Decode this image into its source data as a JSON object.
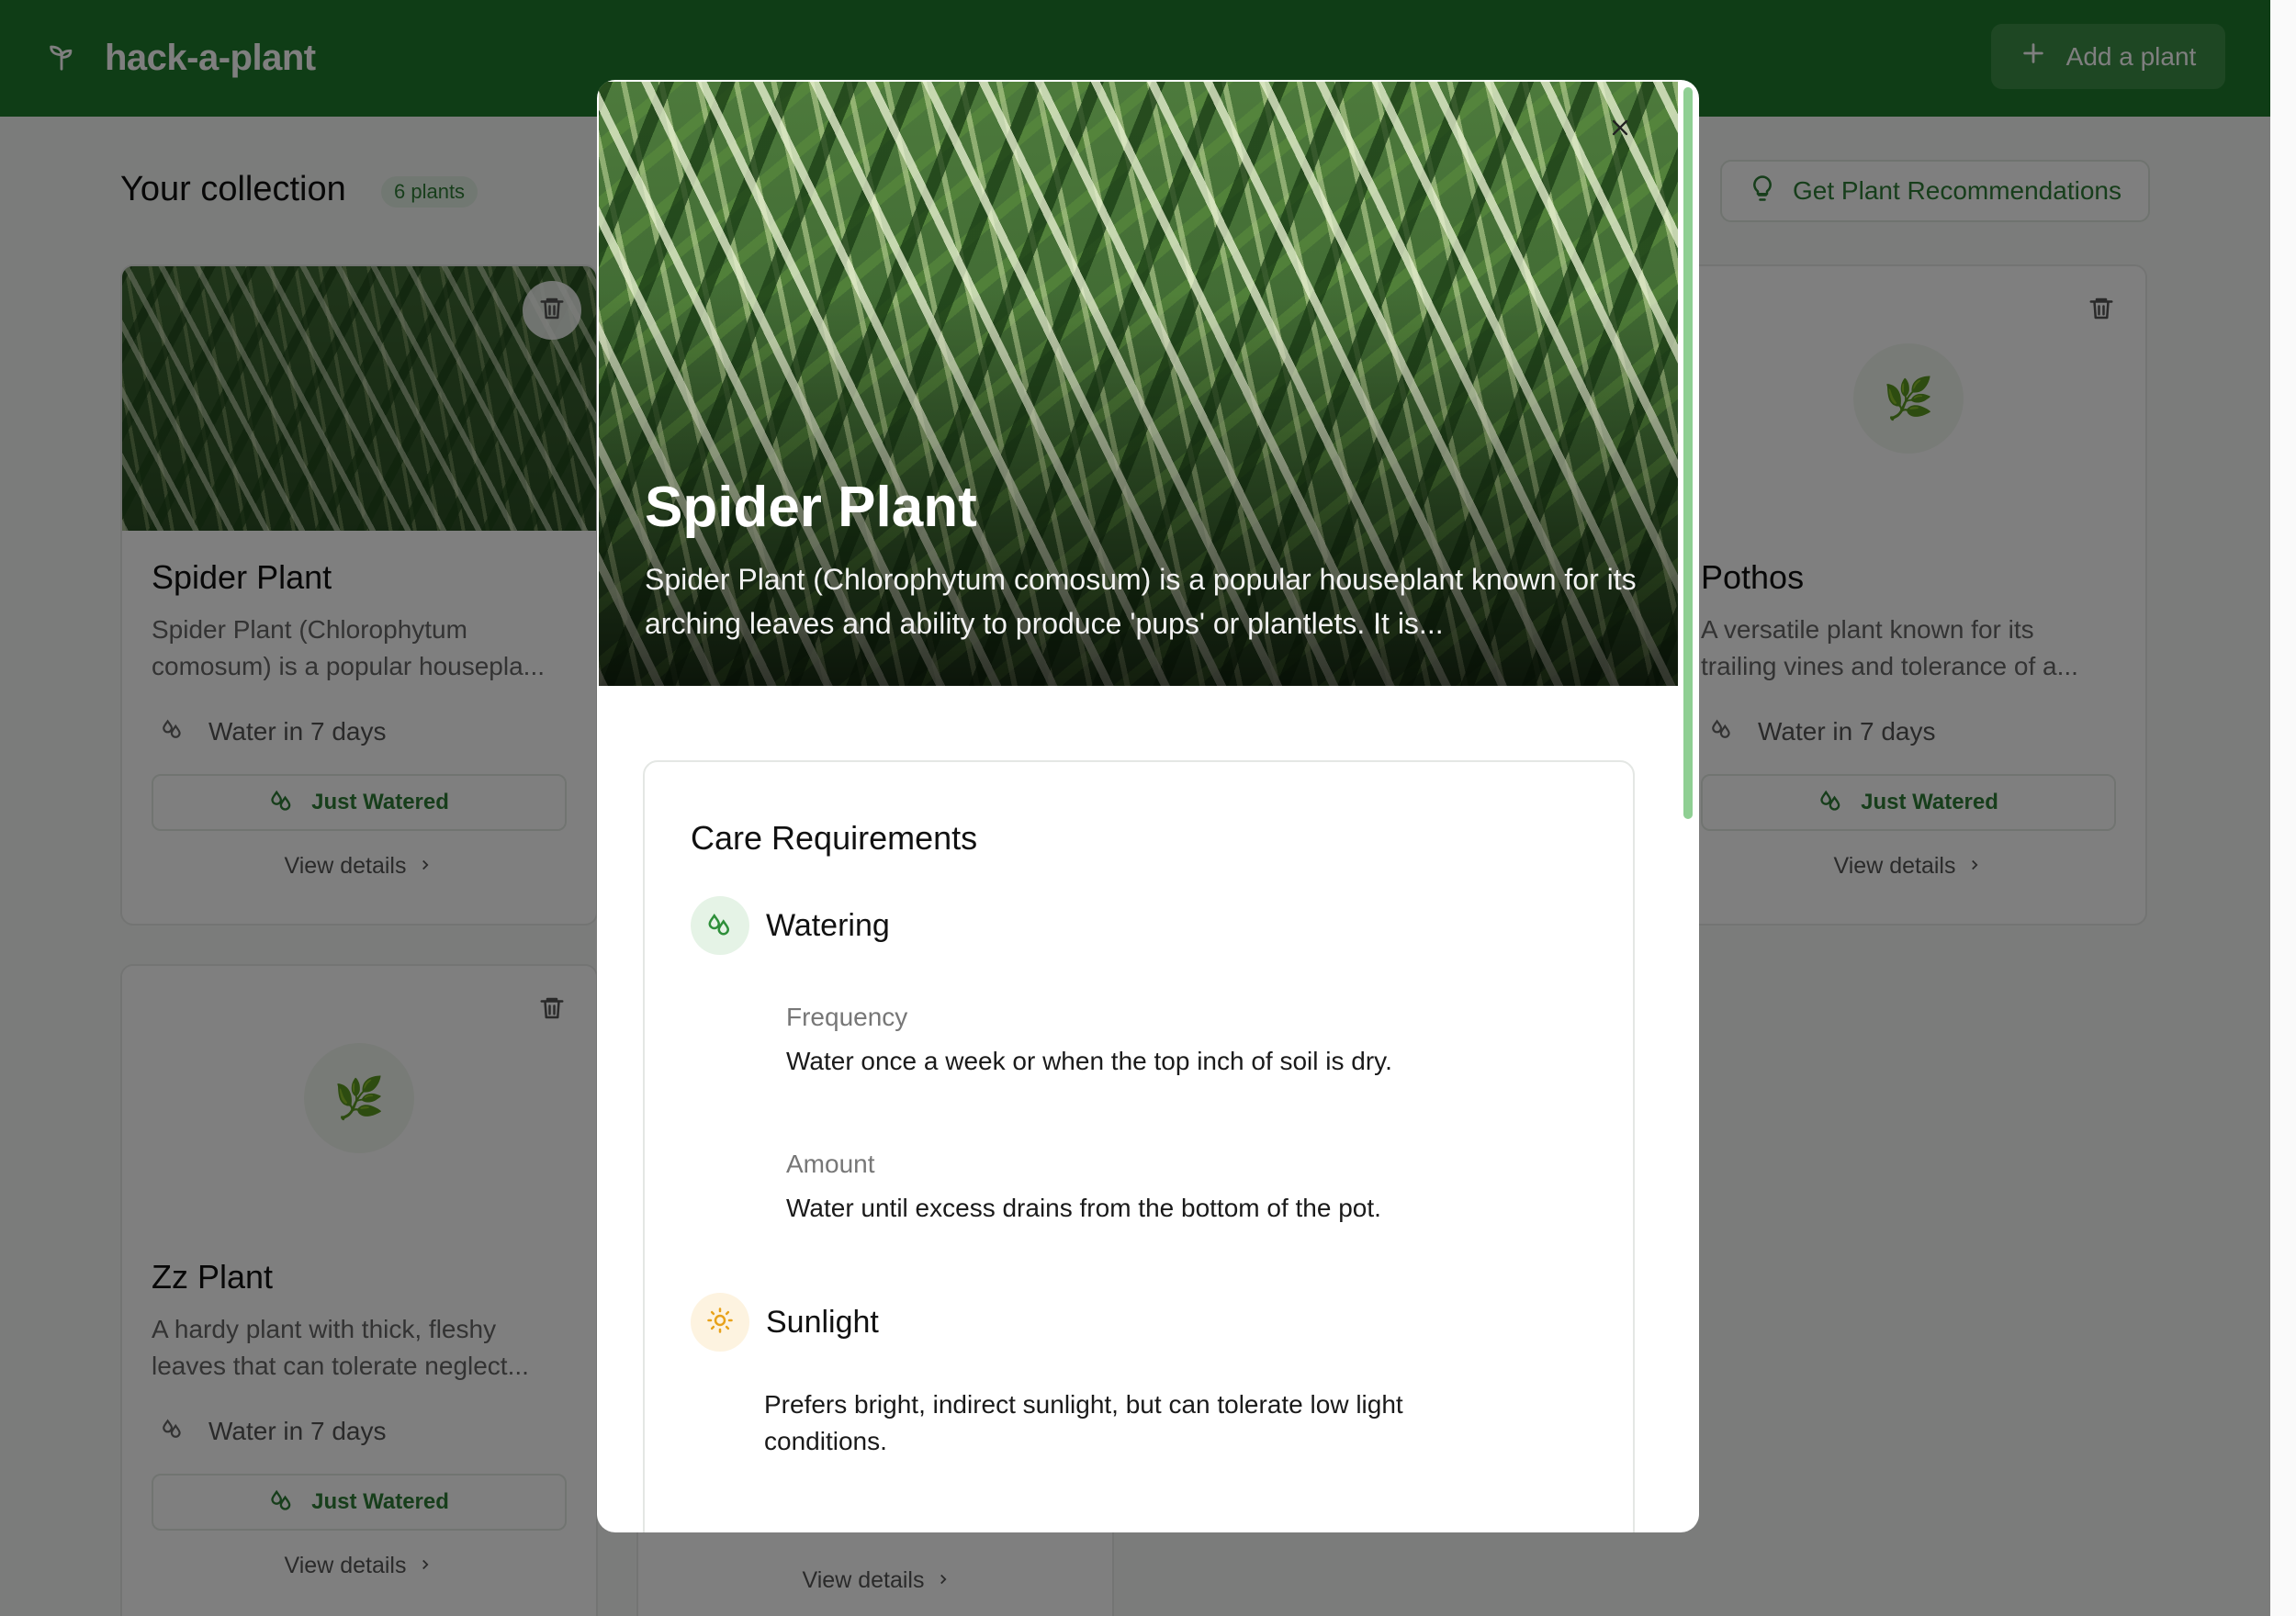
{
  "app": {
    "name": "hack-a-plant",
    "add_button": "Add a plant"
  },
  "collection": {
    "title": "Your collection",
    "count": "6 plants",
    "recommend_button": "Get Plant Recommendations"
  },
  "cards": [
    {
      "name": "Spider Plant",
      "description": "Spider Plant (Chlorophytum comosum) is a popular housepla...",
      "water": "Water in 7 days",
      "watered_button": "Just Watered",
      "details": "View details"
    },
    {
      "name": "Pothos",
      "description": "A versatile plant known for its trailing vines and tolerance of a...",
      "water": "Water in 7 days",
      "watered_button": "Just Watered",
      "details": "View details"
    },
    {
      "name": "Zz Plant",
      "description": "A hardy plant with thick, fleshy leaves that can tolerate neglect...",
      "water": "Water in 7 days",
      "watered_button": "Just Watered",
      "details": "View details"
    },
    {
      "details": "View details"
    }
  ],
  "modal": {
    "title": "Spider Plant",
    "description": "Spider Plant (Chlorophytum comosum) is a popular houseplant known for its arching leaves and ability to produce 'pups' or plantlets. It is...",
    "care": {
      "title": "Care Requirements",
      "watering": {
        "label": "Watering",
        "frequency_label": "Frequency",
        "frequency": "Water once a week or when the top inch of soil is dry.",
        "amount_label": "Amount",
        "amount": "Water until excess drains from the bottom of the pot."
      },
      "sunlight": {
        "label": "Sunlight",
        "text": "Prefers bright, indirect sunlight, but can tolerate low light conditions."
      }
    }
  },
  "colors": {
    "brand_green": "#1f7a2c",
    "accent_green": "#2e7d37",
    "sun_orange": "#e8a21a"
  }
}
